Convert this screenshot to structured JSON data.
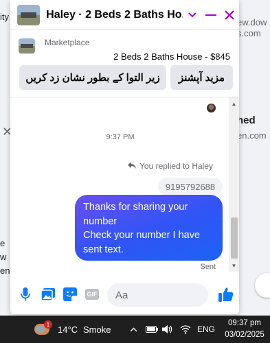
{
  "background": {
    "left_texts": [
      "ity",
      "e",
      "w",
      "ens"
    ],
    "right_texts": [
      "ew.dow",
      "s.com",
      "hed",
      "en.com"
    ]
  },
  "chat": {
    "title": "Haley · 2 Beds 2 Baths Ho...",
    "listing": {
      "source": "Marketplace",
      "title": "2 Beds 2 Baths House - $845",
      "actions": [
        "مزید آپشنز",
        "زیر التوا کے بطور نشان زد کریں"
      ]
    },
    "messages": {
      "timestamp": "9:37 PM",
      "reply_note": "You replied to Haley",
      "quoted_text": "9195792688",
      "bubble_text": "Thanks for sharing your number\n        Check your number I have sent text.",
      "status": "Sent"
    },
    "composer": {
      "placeholder": "Aa",
      "gif_label": "GIF"
    }
  },
  "taskbar": {
    "notification_count": "1",
    "temperature": "14°C",
    "weather": "Smoke",
    "language": "ENG",
    "time": "09:37 pm",
    "date": "03/02/2025"
  },
  "colors": {
    "accent": "#a400e0",
    "messenger_blue": "#0a7cff",
    "bubble_start": "#6a4ff2",
    "bubble_end": "#1e63f5"
  },
  "icons": [
    "chevron-down-icon",
    "minimize-icon",
    "close-icon",
    "reply-icon",
    "microphone-icon",
    "image-icon",
    "sticker-icon",
    "gif-icon",
    "emoji-icon",
    "like-icon",
    "weather-icon",
    "wifi-icon",
    "volume-icon",
    "battery-icon",
    "chevron-up-icon"
  ]
}
